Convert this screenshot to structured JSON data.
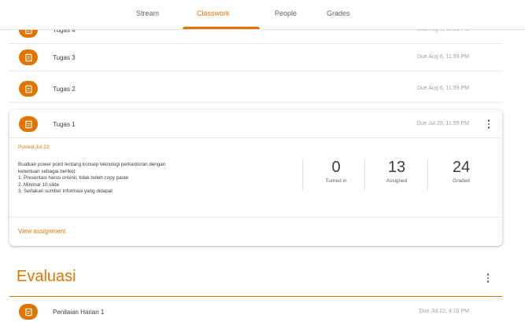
{
  "nav": {
    "tabs": [
      {
        "label": "Stream"
      },
      {
        "label": "Classwork"
      },
      {
        "label": "People"
      },
      {
        "label": "Grades"
      }
    ],
    "active_tab": "Classwork",
    "accent_color": "#e37400"
  },
  "assignments": [
    {
      "title": "Tugas 4",
      "due": "Due Aug 6, 11:59 PM"
    },
    {
      "title": "Tugas 3",
      "due": "Due Aug 6, 11:59 PM"
    },
    {
      "title": "Tugas 2",
      "due": "Due Aug 6, 11:59 PM"
    }
  ],
  "expanded": {
    "title": "Tugas 1",
    "due": "Due Jul 29, 11:59 PM",
    "posted": "Posted Jul 22",
    "description": [
      "Buatkan power point tentang konsep teknologi perkantoran dengan",
      "ketentuan sebagai berikut:",
      "1. Presentasi harus orisinil, tidak boleh copy paste",
      "2. Minimal 10 slide",
      "3. Sertakan sumber informasi yang didapat"
    ],
    "stats": [
      {
        "value": "0",
        "label": "Turned in"
      },
      {
        "value": "13",
        "label": "Assigned"
      },
      {
        "value": "24",
        "label": "Graded"
      }
    ],
    "view_link": "View assignment"
  },
  "topic": {
    "title": "Evaluasi",
    "items": [
      {
        "title": "Penilaian Harian 1",
        "due": "Due Jul 22, 4:10 PM"
      }
    ]
  },
  "icons": {
    "assignment": "assignment-icon",
    "more": "more-vert-icon"
  }
}
